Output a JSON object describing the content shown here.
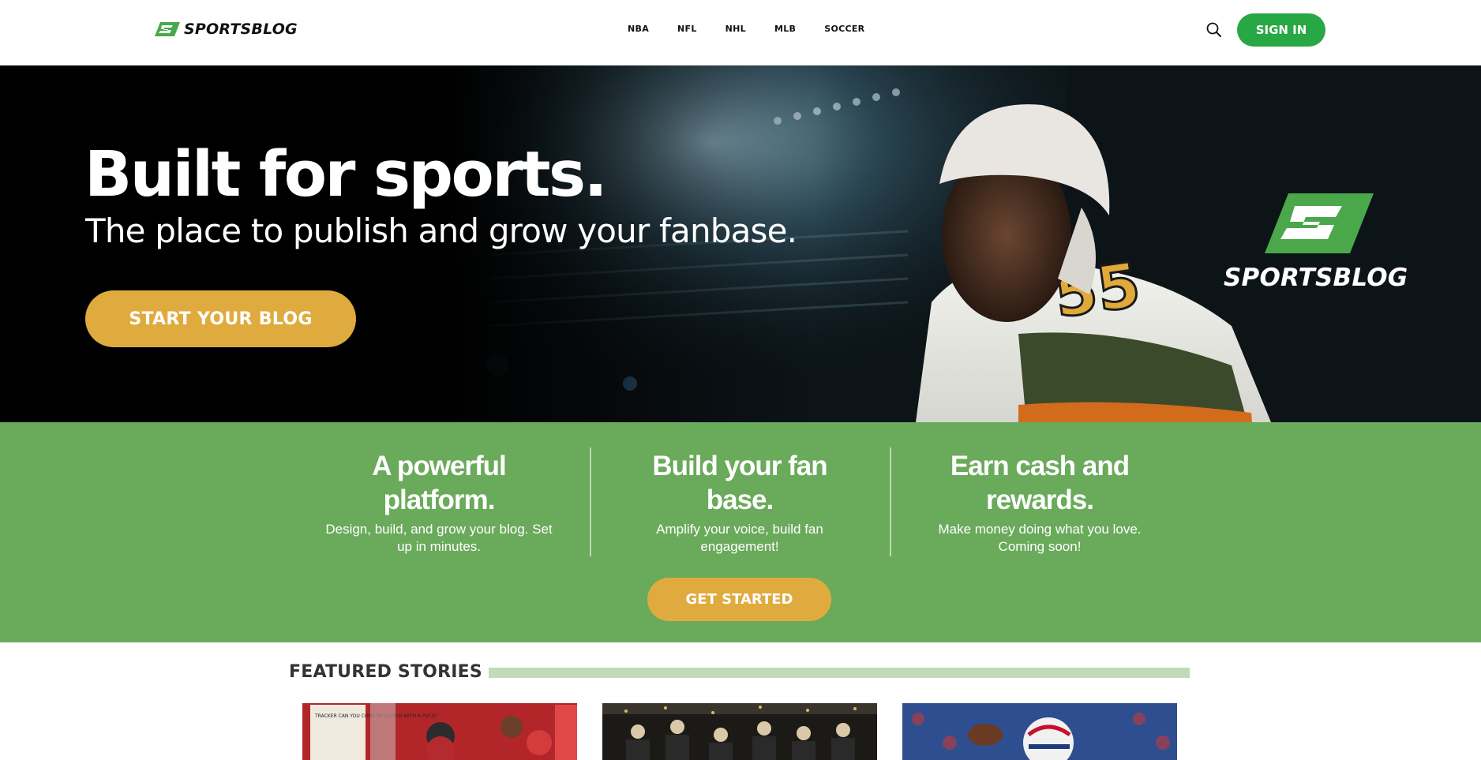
{
  "colors": {
    "brand_green": "#28a745",
    "band_green": "#6aaa5b",
    "cta_gold": "#e0ab3e",
    "logo_green": "#4aa84a"
  },
  "header": {
    "logo_text": "SPORTSBLOG",
    "nav": [
      "NBA",
      "NFL",
      "NHL",
      "MLB",
      "SOCCER"
    ],
    "search_icon": "search-icon",
    "signin_label": "SIGN IN"
  },
  "hero": {
    "title": "Built for sports.",
    "subtitle": "The place to publish and grow your fanbase.",
    "cta_label": "START YOUR BLOG",
    "logo_text": "SPORTSBLOG",
    "jersey_number": "55"
  },
  "features": [
    {
      "title": "A powerful platform.",
      "desc": "Design, build, and grow your blog. Set up in minutes."
    },
    {
      "title": "Build your fan base.",
      "desc": "Amplify your voice, build fan engagement!"
    },
    {
      "title": "Earn cash and rewards.",
      "desc": "Make money doing what you love. Coming soon!"
    }
  ],
  "band_cta_label": "GET STARTED",
  "featured": {
    "heading": "FEATURED STORIES",
    "stories": [
      {
        "image": "hockey-crowd-photo",
        "sign_text": "TRACKER CAN YOU COME IN CLUTCH WITH A PUCK?"
      },
      {
        "image": "championship-celebration-photo"
      },
      {
        "image": "football-player-photo"
      }
    ]
  }
}
